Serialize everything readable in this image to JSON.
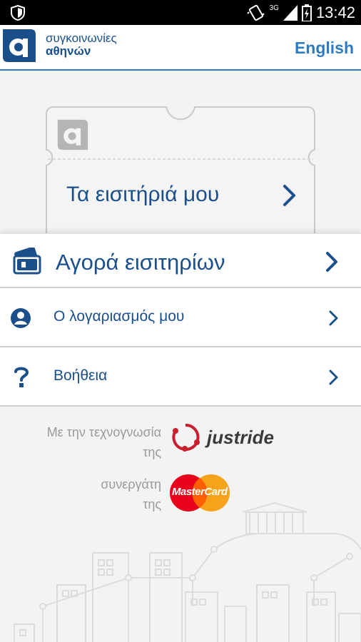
{
  "status_bar": {
    "time": "13:42",
    "network": "3G"
  },
  "header": {
    "logo_line1": "συγκοινωνίες",
    "logo_line2": "αθηνών",
    "language_link": "English"
  },
  "ticket": {
    "label": "Τα εισιτήριά μου"
  },
  "menu": {
    "items": [
      {
        "label": "Αγορά εισιτηρίων",
        "icon": "tickets-icon"
      },
      {
        "label": "Ο λογαριασμός μου",
        "icon": "user-icon"
      },
      {
        "label": "Βοήθεια",
        "icon": "question-icon"
      }
    ]
  },
  "partners": {
    "tech_label_line1": "Με την τεχνογνωσία",
    "tech_label_line2": "της",
    "tech_partner": "justride",
    "partner_label_line1": "συνεργάτη",
    "partner_label_line2": "της",
    "card_partner": "MasterCard"
  },
  "colors": {
    "brand": "#1b4f8c",
    "accent": "#2f7bc0",
    "mastercard_red": "#e8001c",
    "mastercard_yellow": "#f7a21b",
    "justride_red": "#c8202f"
  }
}
